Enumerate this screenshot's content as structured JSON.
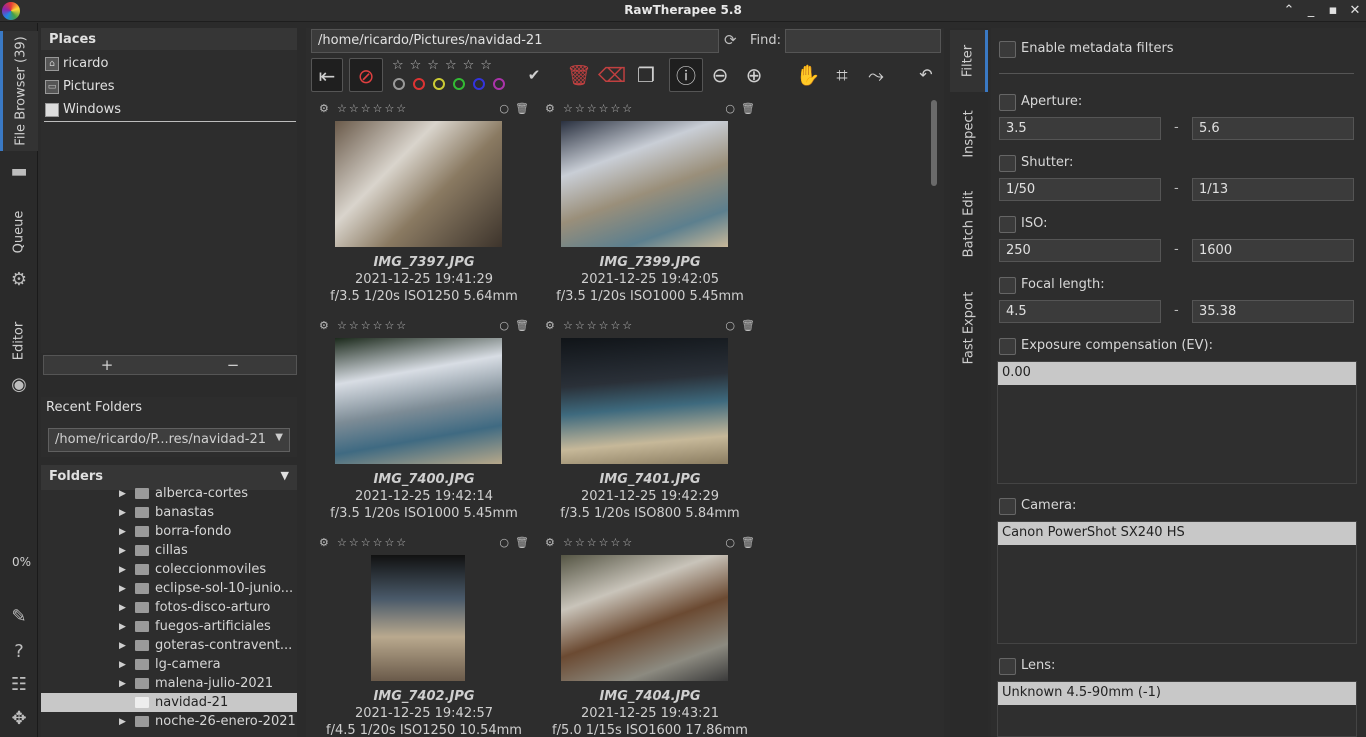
{
  "window": {
    "title": "RawTherapee 5.8"
  },
  "left_tabs": {
    "file_browser": "File Browser (39)",
    "queue": "Queue",
    "editor": "Editor",
    "zoom_percent": "0%"
  },
  "places": {
    "title": "Places",
    "items": [
      {
        "label": "ricardo",
        "icon": "home-folder-icon"
      },
      {
        "label": "Pictures",
        "icon": "folder-icon"
      },
      {
        "label": "Windows",
        "icon": "drive-icon"
      }
    ],
    "add": "+",
    "remove": "−"
  },
  "recent": {
    "title": "Recent Folders",
    "value": "/home/ricardo/P...res/navidad-21"
  },
  "folders": {
    "title": "Folders",
    "items": [
      {
        "label": "alberca-cortes",
        "selected": false,
        "expandable": true
      },
      {
        "label": "banastas",
        "selected": false,
        "expandable": true
      },
      {
        "label": "borra-fondo",
        "selected": false,
        "expandable": true
      },
      {
        "label": "cillas",
        "selected": false,
        "expandable": true
      },
      {
        "label": "coleccionmoviles",
        "selected": false,
        "expandable": true
      },
      {
        "label": "eclipse-sol-10-junio...",
        "selected": false,
        "expandable": true
      },
      {
        "label": "fotos-disco-arturo",
        "selected": false,
        "expandable": true
      },
      {
        "label": "fuegos-artificiales",
        "selected": false,
        "expandable": true
      },
      {
        "label": "goteras-contravent...",
        "selected": false,
        "expandable": true
      },
      {
        "label": "lg-camera",
        "selected": false,
        "expandable": true
      },
      {
        "label": "malena-julio-2021",
        "selected": false,
        "expandable": true
      },
      {
        "label": "navidad-21",
        "selected": true,
        "expandable": false
      },
      {
        "label": "noche-26-enero-2021",
        "selected": false,
        "expandable": true
      }
    ]
  },
  "browser": {
    "path": "/home/ricardo/Pictures/navidad-21",
    "find_label": "Find:",
    "find_value": "",
    "thumbnails": [
      {
        "name": "IMG_7397.JPG",
        "date": "2021-12-25 19:41:29",
        "exif": "f/3.5 1/20s ISO1250 5.64mm",
        "orientation": "landscape"
      },
      {
        "name": "IMG_7399.JPG",
        "date": "2021-12-25 19:42:05",
        "exif": "f/3.5 1/20s ISO1000 5.45mm",
        "orientation": "landscape"
      },
      {
        "name": "IMG_7400.JPG",
        "date": "2021-12-25 19:42:14",
        "exif": "f/3.5 1/20s ISO1000 5.45mm",
        "orientation": "landscape"
      },
      {
        "name": "IMG_7401.JPG",
        "date": "2021-12-25 19:42:29",
        "exif": "f/3.5 1/20s ISO800 5.84mm",
        "orientation": "landscape"
      },
      {
        "name": "IMG_7402.JPG",
        "date": "2021-12-25 19:42:57",
        "exif": "f/4.5 1/20s ISO1250 10.54mm",
        "orientation": "portrait"
      },
      {
        "name": "IMG_7404.JPG",
        "date": "2021-12-25 19:43:21",
        "exif": "f/5.0 1/15s ISO1600 17.86mm",
        "orientation": "landscape"
      }
    ]
  },
  "right_tabs": {
    "filter": "Filter",
    "inspect": "Inspect",
    "batch_edit": "Batch Edit",
    "fast_export": "Fast Export"
  },
  "filter": {
    "enable_metadata": "Enable metadata filters",
    "aperture": {
      "label": "Aperture:",
      "from": "3.5",
      "to": "5.6"
    },
    "shutter": {
      "label": "Shutter:",
      "from": "1/50",
      "to": "1/13"
    },
    "iso": {
      "label": "ISO:",
      "from": "250",
      "to": "1600"
    },
    "focal": {
      "label": "Focal length:",
      "from": "4.5",
      "to": "35.38"
    },
    "exposure": {
      "label": "Exposure compensation (EV):",
      "value": "0.00"
    },
    "camera": {
      "label": "Camera:",
      "value": "Canon PowerShot SX240 HS"
    },
    "lens": {
      "label": "Lens:",
      "value": "Unknown 4.5-90mm (-1)"
    },
    "range_sep": "-"
  }
}
